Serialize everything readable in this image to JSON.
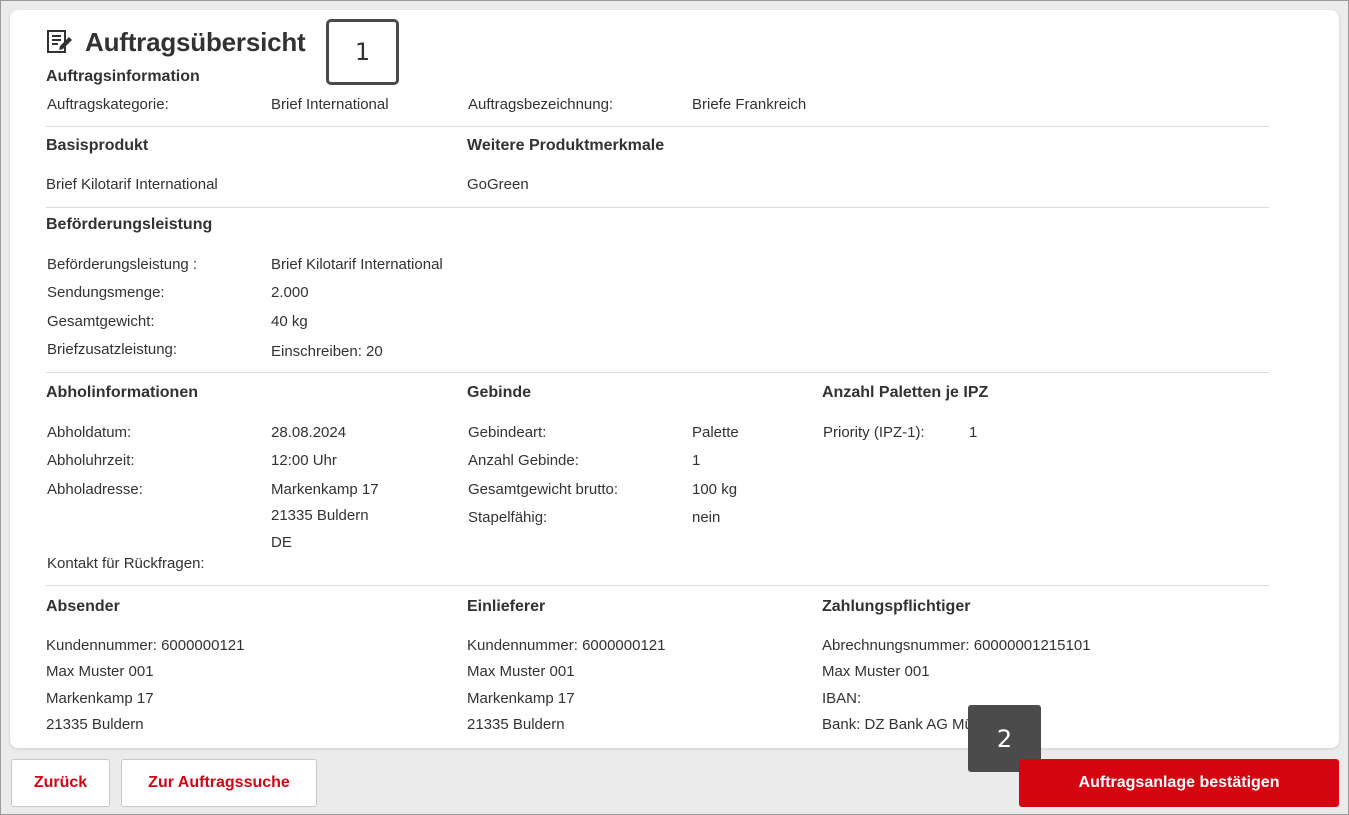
{
  "colors": {
    "accent": "#d40511",
    "text": "#323232",
    "annotation_dark": "#4b4b4b"
  },
  "header": {
    "title": "Auftragsübersicht",
    "icon": "order-edit-icon"
  },
  "annotations": {
    "marker_1": "1",
    "marker_2": "2"
  },
  "auftragsinformation": {
    "title": "Auftragsinformation",
    "kategorie_label": "Auftragskategorie:",
    "kategorie_value": "Brief International",
    "bezeichnung_label": "Auftragsbezeichnung:",
    "bezeichnung_value": "Briefe Frankreich"
  },
  "basisprodukt": {
    "title": "Basisprodukt",
    "value": "Brief Kilotarif International"
  },
  "weitere": {
    "title": "Weitere Produktmerkmale",
    "value": "GoGreen"
  },
  "befoerderung": {
    "title": "Beförderungsleistung",
    "rows": [
      {
        "label": "Beförderungsleistung :",
        "value": "Brief Kilotarif International"
      },
      {
        "label": "Sendungsmenge:",
        "value": "2.000"
      },
      {
        "label": "Gesamtgewicht:",
        "value": "40 kg"
      },
      {
        "label": "Briefzusatzleistung:",
        "value": "Einschreiben: 20"
      }
    ]
  },
  "abholung": {
    "title": "Abholinformationen",
    "datum_label": "Abholdatum:",
    "datum_value": "28.08.2024",
    "uhrzeit_label": "Abholuhrzeit:",
    "uhrzeit_value": "12:00 Uhr",
    "adresse_label": "Abholadresse:",
    "adresse_lines": [
      "Markenkamp 17",
      "21335 Buldern",
      "DE"
    ],
    "kontakt_label": "Kontakt für Rückfragen:"
  },
  "gebinde": {
    "title": "Gebinde",
    "rows": [
      {
        "label": "Gebindeart:",
        "value": "Palette"
      },
      {
        "label": "Anzahl Gebinde:",
        "value": "1"
      },
      {
        "label": "Gesamtgewicht brutto:",
        "value": "100 kg"
      },
      {
        "label": "Stapelfähig:",
        "value": "nein"
      }
    ]
  },
  "paletten": {
    "title": "Anzahl Paletten je IPZ",
    "label": "Priority (IPZ-1):",
    "value": "1"
  },
  "absender": {
    "title": "Absender",
    "lines": [
      "Kundennummer: 6000000121",
      "Max Muster 001",
      "Markenkamp 17",
      "21335 Buldern"
    ]
  },
  "einlieferer": {
    "title": "Einlieferer",
    "lines": [
      "Kundennummer: 6000000121",
      "Max Muster 001",
      "Markenkamp 17",
      "21335 Buldern"
    ]
  },
  "zahlung": {
    "title": "Zahlungspflichtiger",
    "lines": [
      "Abrechnungsnummer: 60000001215101",
      "Max Muster 001",
      "IBAN:",
      "Bank: DZ Bank AG Mü"
    ]
  },
  "buttons": {
    "back": "Zurück",
    "search": "Zur Auftragssuche",
    "confirm": "Auftragsanlage bestätigen"
  }
}
